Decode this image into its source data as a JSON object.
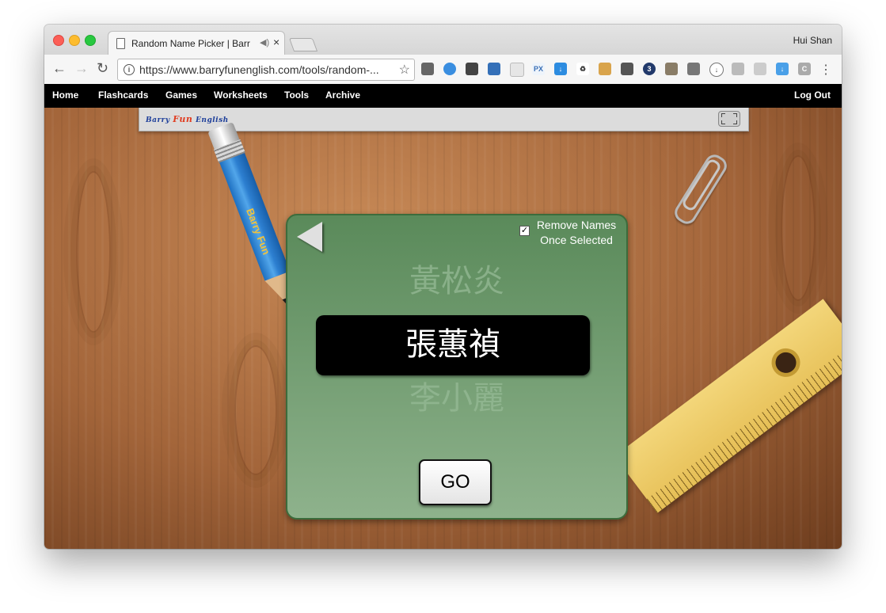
{
  "browser": {
    "tab_title": "Random Name Picker | Barr",
    "tab_audio_icon": "speaker-icon",
    "profile_name": "Hui Shan",
    "url": "https://www.barryfunenglish.com/tools/random-..."
  },
  "sitenav": {
    "items": [
      "Home",
      "Flashcards",
      "Games",
      "Worksheets",
      "Tools",
      "Archive"
    ],
    "logout": "Log Out"
  },
  "logo": {
    "text_left": "Barry",
    "text_mid": "Fun",
    "text_right": "English"
  },
  "picker": {
    "option_label_line1": "Remove Names",
    "option_label_line2": "Once Selected",
    "option_checked": true,
    "check_mark": "✓",
    "name_previous": "黃松炎",
    "name_current": "張蕙禎",
    "name_next": "李小麗",
    "go_label": "GO"
  },
  "pencil": {
    "brand": "Barry Fun"
  },
  "colors": {
    "panel": "#5a8a5a",
    "nav_bg": "#000000",
    "name_box": "#000000"
  }
}
